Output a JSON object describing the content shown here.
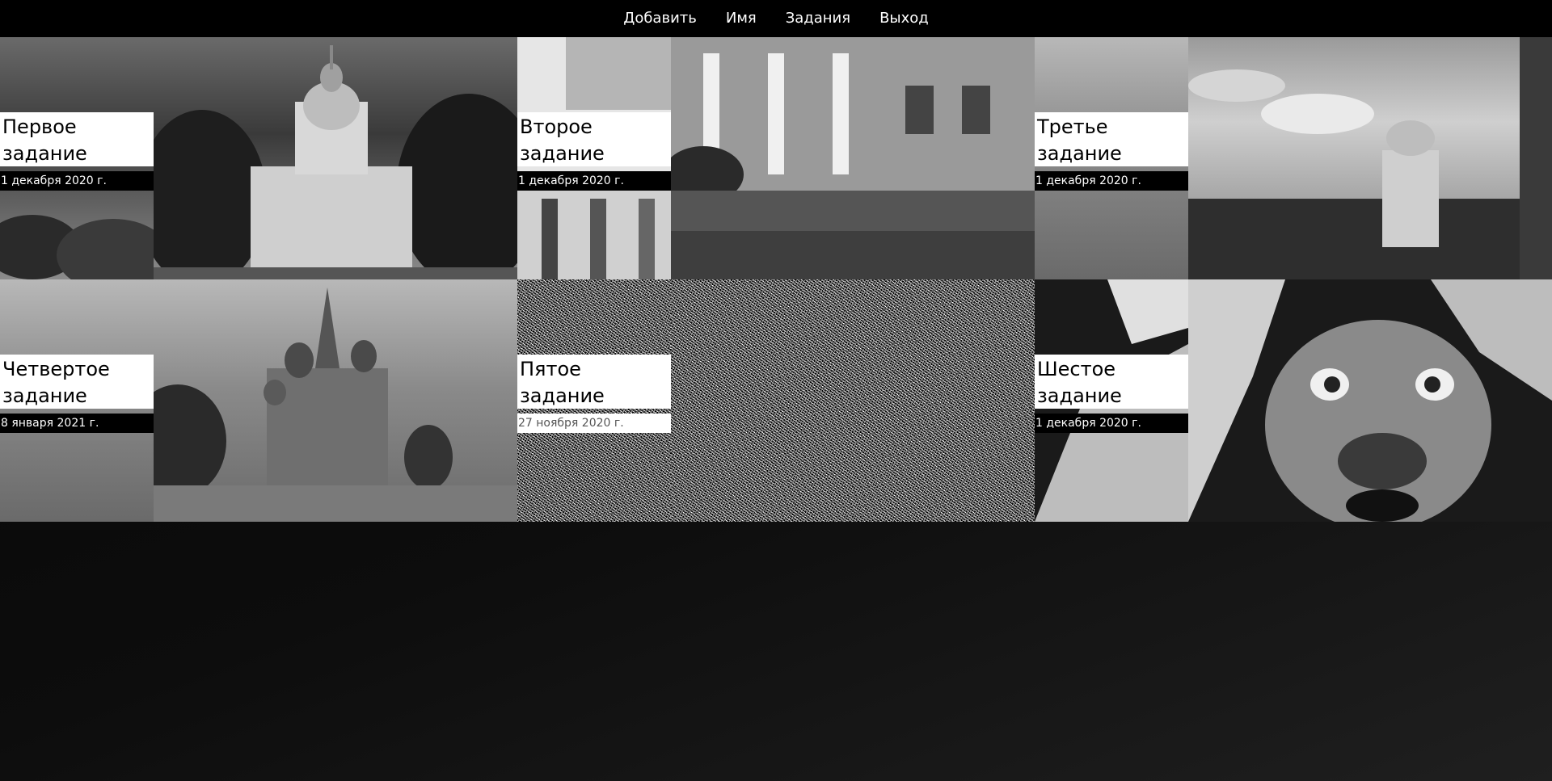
{
  "nav": {
    "items": [
      {
        "label": "Добавить"
      },
      {
        "label": "Имя"
      },
      {
        "label": "Задания"
      },
      {
        "label": "Выход"
      }
    ]
  },
  "cards": [
    {
      "title_line1": "Первое",
      "title_line2": "задание",
      "date": "1 декабря 2020 г."
    },
    {
      "title_line1": "Второе",
      "title_line2": "задание",
      "date": "1 декабря 2020 г."
    },
    {
      "title_line1": "Третье",
      "title_line2": "задание",
      "date": "1 декабря 2020 г."
    },
    {
      "title_line1": "Четвертое",
      "title_line2": "задание",
      "date": "8 января 2021 г."
    },
    {
      "title_line1": "Пятое",
      "title_line2": "задание",
      "date": "27 ноября 2020 г."
    },
    {
      "title_line1": "Шестое",
      "title_line2": "задание",
      "date": "1 декабря 2020 г."
    }
  ],
  "colors": {
    "nav_bg": "#000000",
    "page_bg": "#0d0d0d",
    "title_bg": "#ffffff",
    "date_bg": "#000000"
  }
}
